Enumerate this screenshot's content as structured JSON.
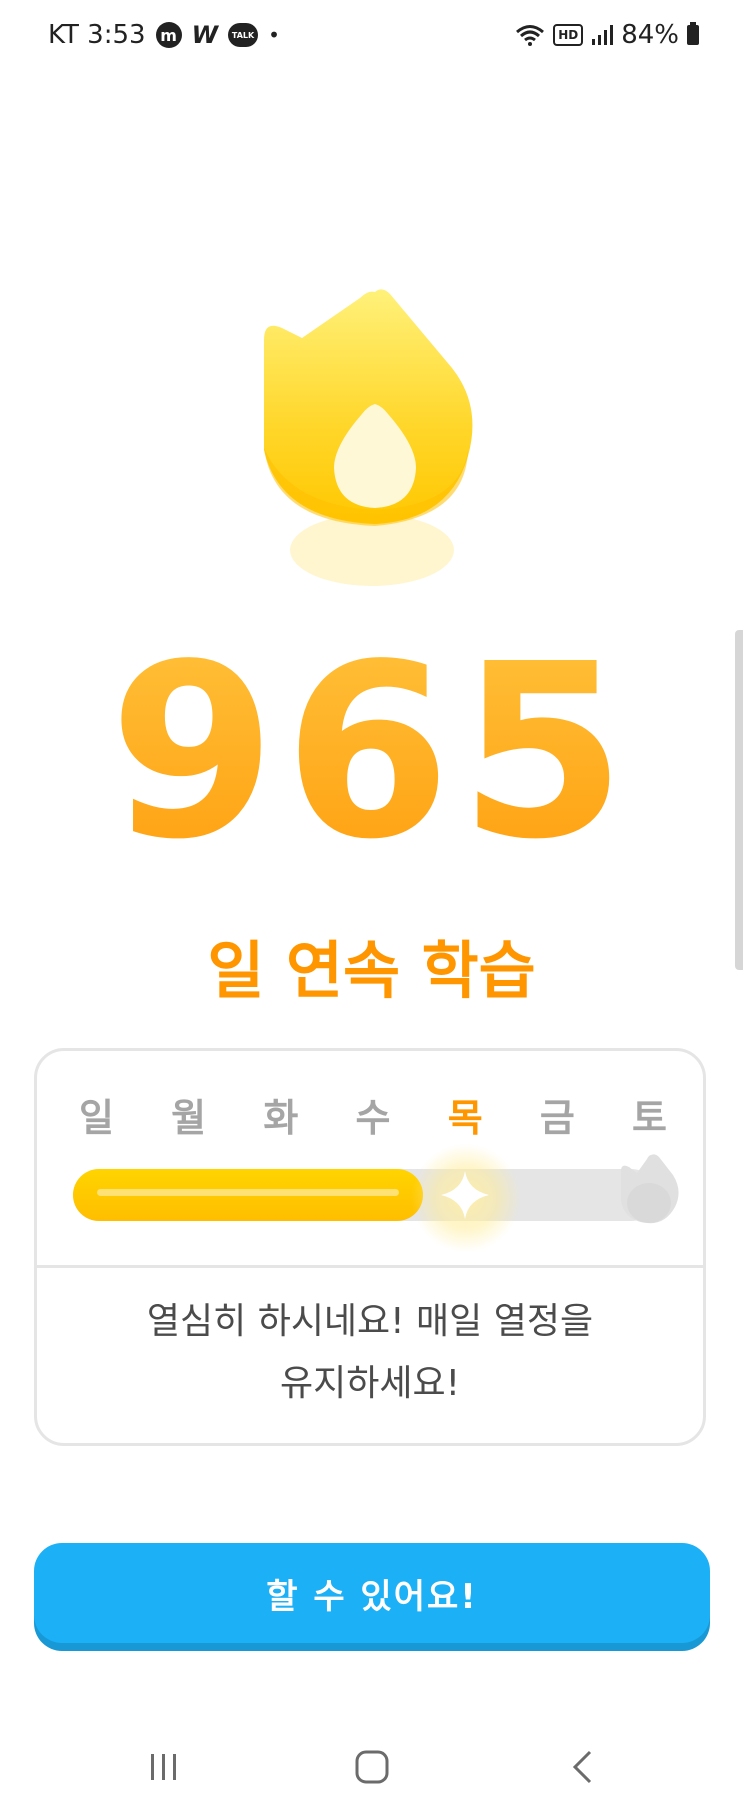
{
  "status_bar": {
    "carrier_time": "KT 3:53",
    "app_badge_m": "m",
    "app_badge_w": "W",
    "app_badge_talk": "TALK",
    "dot": "•",
    "hd": "HD",
    "battery_percent": "84%"
  },
  "streak": {
    "count": "965",
    "label": "일 연속 학습",
    "accent_color": "#ff9600"
  },
  "week": {
    "days": [
      "일",
      "월",
      "화",
      "수",
      "목",
      "금",
      "토"
    ],
    "active_index": 4,
    "progress_fraction": 0.6
  },
  "message": {
    "line1": "열심히 하시네요! 매일 열정을",
    "line2": "유지하세요!"
  },
  "button": {
    "label": "할 수 있어요!",
    "color": "#1cb0f6"
  },
  "nav": {
    "icons": [
      "recent-apps-icon",
      "home-icon",
      "back-icon"
    ]
  }
}
